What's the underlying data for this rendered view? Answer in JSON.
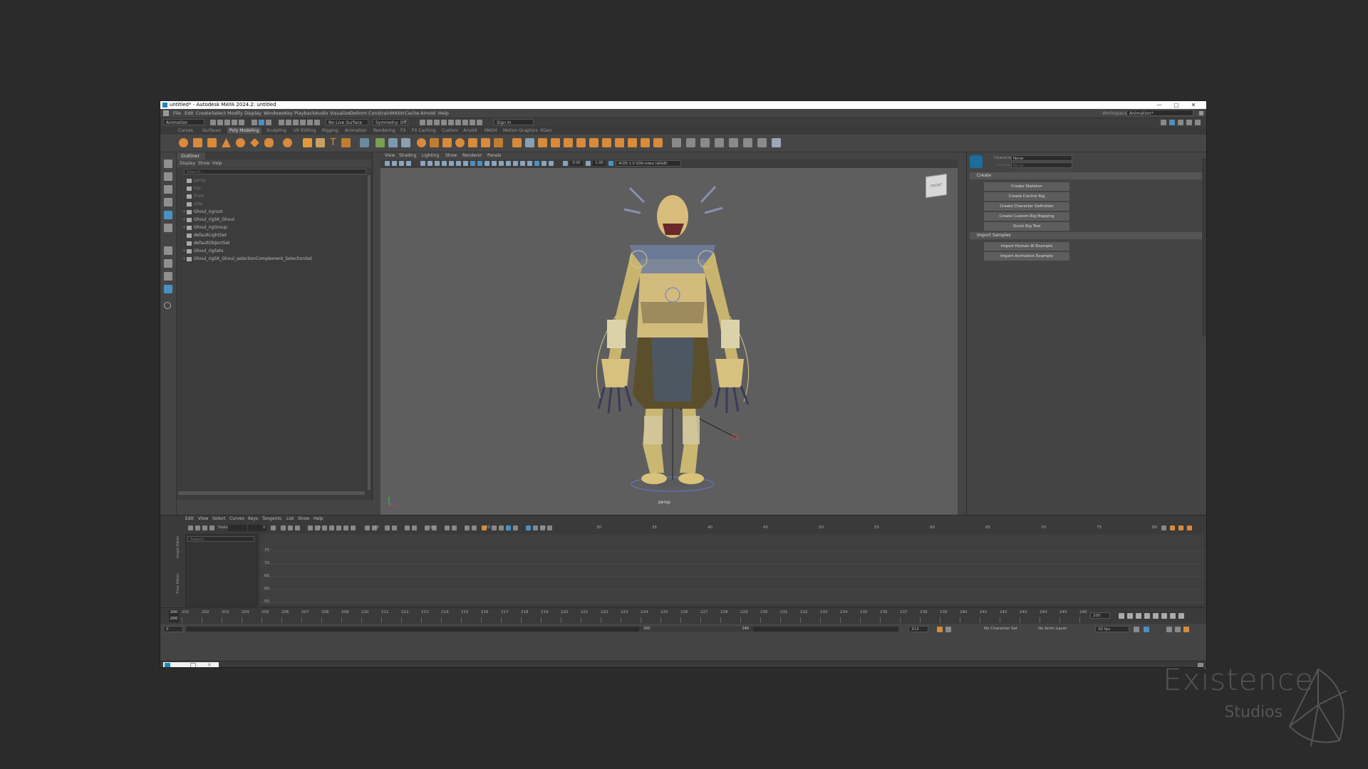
{
  "window": {
    "title": "untitled* - Autodesk MAYA 2024.2: untitled",
    "controls": [
      "—",
      "▢",
      "✕"
    ]
  },
  "menubar": {
    "items": [
      "File",
      "Edit",
      "Create",
      "Select",
      "Modify",
      "Display",
      "Windows",
      "Key",
      "Playback",
      "Audio",
      "Visualize",
      "Deform",
      "Constrain",
      "MASH",
      "Cache",
      "Arnold",
      "Help"
    ],
    "workspace_label": "Workspace:",
    "workspace_value": "Animation*"
  },
  "statusline": {
    "menuset": "Animation",
    "live_surface": "No Live Surface",
    "symmetry": "Symmetry: Off",
    "sign_in": "Sign In"
  },
  "shelf_tabs": [
    "Curves",
    "Surfaces",
    "Poly Modeling",
    "Sculpting",
    "UV Editing",
    "Rigging",
    "Animation",
    "Rendering",
    "FX",
    "FX Caching",
    "Custom",
    "Arnold",
    "MASH",
    "Motion Graphics",
    "XGen"
  ],
  "shelf_active": "Poly Modeling",
  "outliner": {
    "tab": "Outliner",
    "menu": [
      "Display",
      "Show",
      "Help"
    ],
    "search_placeholder": "Search...",
    "items": [
      {
        "label": "persp",
        "type": "camera",
        "dim": true
      },
      {
        "label": "top",
        "type": "camera",
        "dim": true
      },
      {
        "label": "front",
        "type": "camera",
        "dim": true
      },
      {
        "label": "side",
        "type": "camera",
        "dim": true
      },
      {
        "label": "Ghoul_rigroot",
        "type": "joint",
        "dim": false
      },
      {
        "label": "Ghoul_rigSK_Ghoul",
        "type": "set",
        "dim": false
      },
      {
        "label": "Ghoul_rigGroup",
        "type": "group",
        "dim": false
      },
      {
        "label": "defaultLightSet",
        "type": "set",
        "dim": false
      },
      {
        "label": "defaultObjectSet",
        "type": "set",
        "dim": false
      },
      {
        "label": "Ghoul_rigSets",
        "type": "set",
        "dim": false
      },
      {
        "label": "Ghoul_rigSK_Ghoul_selectionComplement_SelectionSet",
        "type": "set",
        "dim": false
      }
    ]
  },
  "viewport": {
    "menu": [
      "View",
      "Shading",
      "Lighting",
      "Show",
      "Renderer",
      "Panels"
    ],
    "field_a": "0.00",
    "field_b": "1.00",
    "color_space": "ACES 1.0 SDR-video (sRGB)",
    "camera": "persp",
    "viewcube": "FRONT"
  },
  "hik": {
    "character_label": "Character:",
    "character_value": "None",
    "source_label": "Source:",
    "source_value": "None",
    "sections": [
      {
        "title": "Create",
        "buttons": [
          "Create Skeleton",
          "Create Control Rig",
          "Create Character Definition",
          "Create Custom Rig Mapping",
          "Quick Rig Tool"
        ]
      },
      {
        "title": "Import Samples",
        "buttons": [
          "Import Human IK Example",
          "Import Animation Example"
        ]
      }
    ]
  },
  "graph_editor": {
    "menu": [
      "Edit",
      "View",
      "Select",
      "Curves",
      "Keys",
      "Tangents",
      "List",
      "Show",
      "Help"
    ],
    "stats_label": "Stats",
    "search_placeholder": "Search...",
    "tabs": [
      "Graph Editor",
      "Time Editor"
    ],
    "y_ticks": [
      "75",
      "70",
      "65",
      "60",
      "55"
    ],
    "x_ticks": [
      "0",
      "5",
      "10",
      "15",
      "20",
      "25",
      "30",
      "35",
      "40",
      "45",
      "50",
      "55",
      "60",
      "65",
      "70",
      "75",
      "80"
    ]
  },
  "timeline": {
    "current_frame_top": "200",
    "current_frame_bottom": "200",
    "ticks": [
      "201",
      "202",
      "203",
      "204",
      "205",
      "206",
      "207",
      "208",
      "209",
      "210",
      "211",
      "212",
      "213",
      "214",
      "215",
      "216",
      "217",
      "218",
      "219",
      "220",
      "221",
      "222",
      "223",
      "224",
      "225",
      "226",
      "227",
      "228",
      "229",
      "230",
      "231",
      "232",
      "233",
      "234",
      "235",
      "236",
      "237",
      "238",
      "239",
      "240",
      "241",
      "242",
      "243",
      "244",
      "245",
      "246"
    ],
    "current_frame_field": "200"
  },
  "range": {
    "start": "0",
    "range_start": "200",
    "range_end": "246",
    "end": "313",
    "character_set": "No Character Set",
    "anim_layer": "No Anim Layer",
    "fps": "30 fps"
  },
  "branding": {
    "name": "Existence",
    "sub": "Studios"
  },
  "colors": {
    "accent_blue": "#4a90c2",
    "shelf_orange": "#d98a3a",
    "maya_blue": "#1b8ab6"
  }
}
